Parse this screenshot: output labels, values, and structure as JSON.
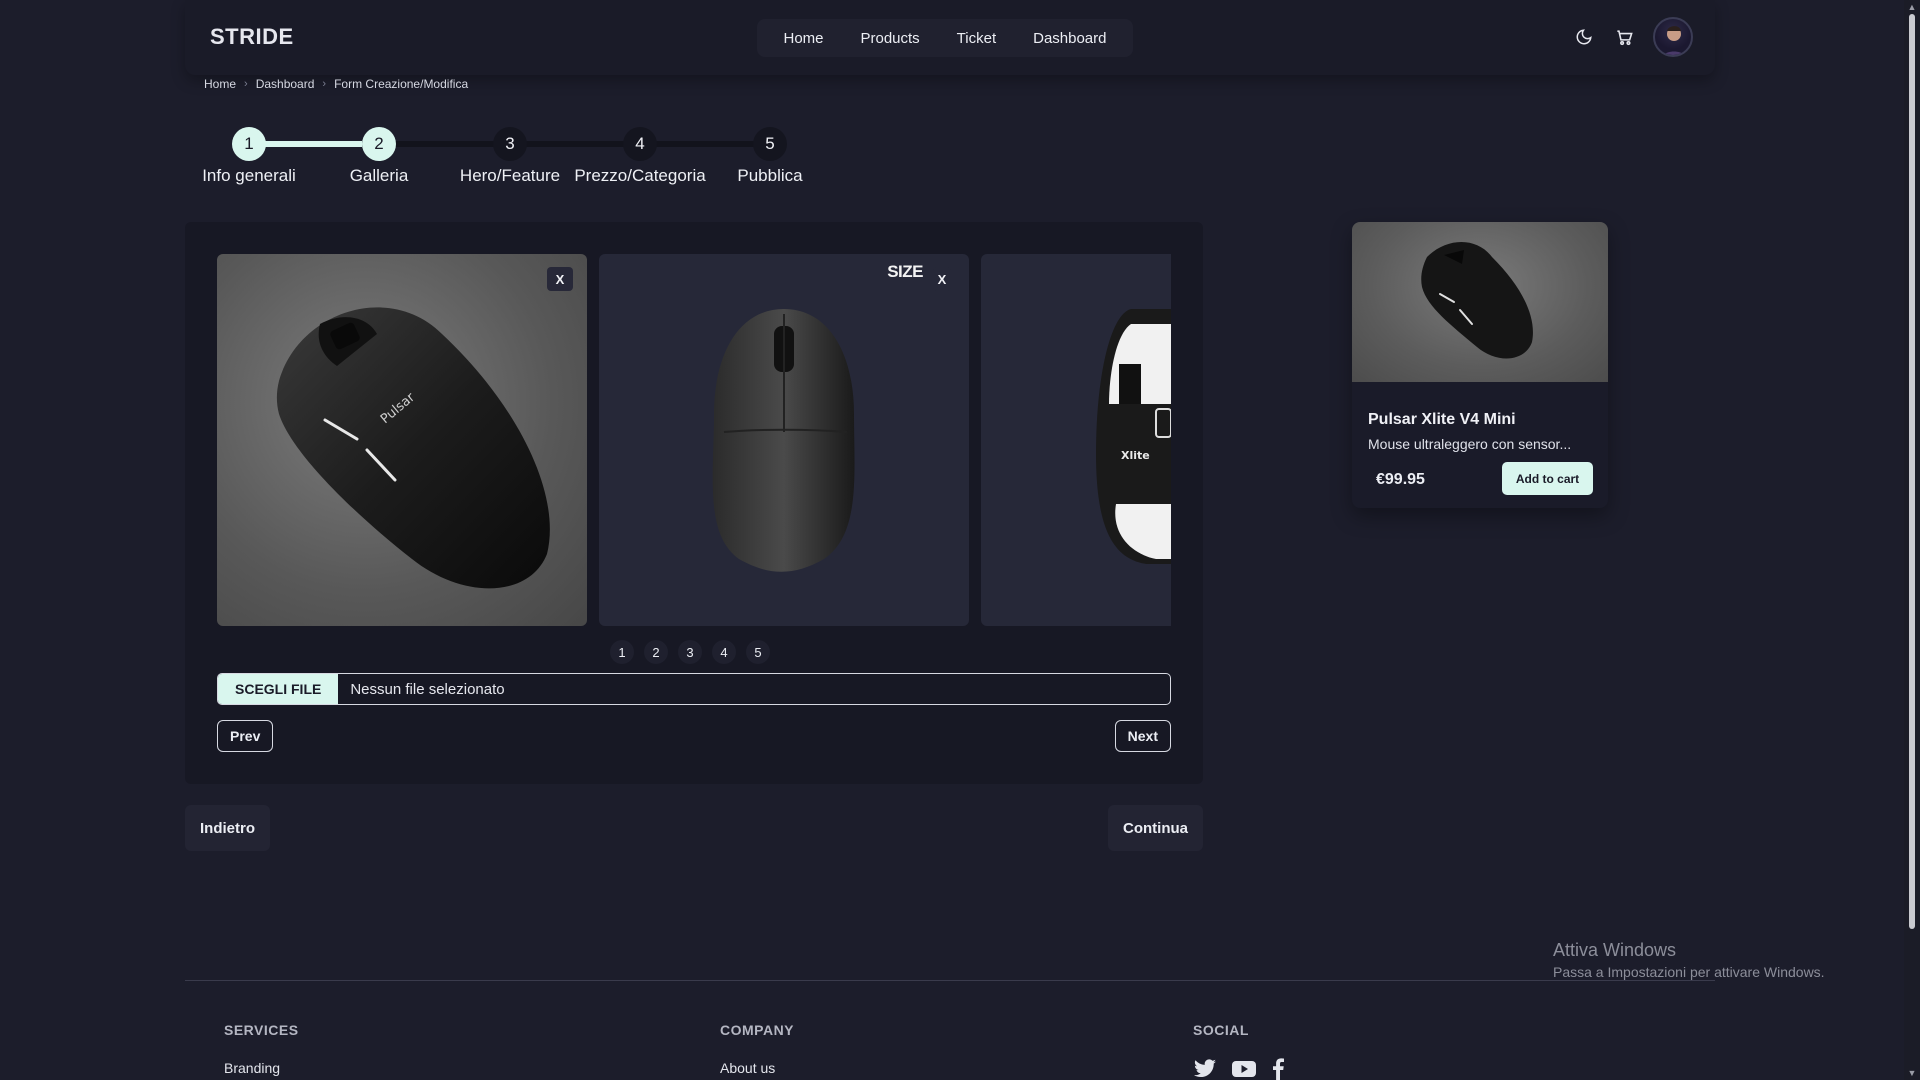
{
  "app": {
    "logo": "STRIDE"
  },
  "nav": {
    "links": [
      "Home",
      "Products",
      "Ticket",
      "Dashboard"
    ]
  },
  "icons": {
    "theme": "moon-icon",
    "cart": "cart-icon",
    "avatar": "user-avatar"
  },
  "breadcrumb": [
    "Home",
    "Dashboard",
    "Form Creazione/Modifica"
  ],
  "stepper": {
    "steps": [
      {
        "number": "1",
        "label": "Info generali"
      },
      {
        "number": "2",
        "label": "Galleria"
      },
      {
        "number": "3",
        "label": "Hero/Feature"
      },
      {
        "number": "4",
        "label": "Prezzo/Categoria"
      },
      {
        "number": "5",
        "label": "Pubblica"
      }
    ],
    "current": 2
  },
  "gallery": {
    "close_label": "X",
    "size_label": "SIZE",
    "pages": [
      "1",
      "2",
      "3",
      "4",
      "5"
    ],
    "slides": [
      "slide-top-view",
      "slide-front-view",
      "slide-bottom-view"
    ]
  },
  "file_input": {
    "button": "SCEGLI FILE",
    "status": "Nessun file selezionato"
  },
  "carousel_nav": {
    "prev": "Prev",
    "next": "Next"
  },
  "form_nav": {
    "back": "Indietro",
    "continue": "Continua"
  },
  "product": {
    "title": "Pulsar Xlite V4 Mini",
    "description": "Mouse ultraleggero con sensor...",
    "price": "€99.95",
    "add_to_cart": "Add to cart"
  },
  "watermark": {
    "title": "Attiva Windows",
    "subtitle": "Passa a Impostazioni per attivare Windows."
  },
  "footer": {
    "services": {
      "heading": "SERVICES",
      "link": "Branding"
    },
    "company": {
      "heading": "COMPANY",
      "link": "About us"
    },
    "social": {
      "heading": "SOCIAL",
      "icons": [
        "twitter-icon",
        "youtube-icon",
        "facebook-icon"
      ]
    }
  },
  "colors": {
    "background": "#1c1d2b",
    "accent": "#d9f6ee",
    "card": "#171824"
  }
}
